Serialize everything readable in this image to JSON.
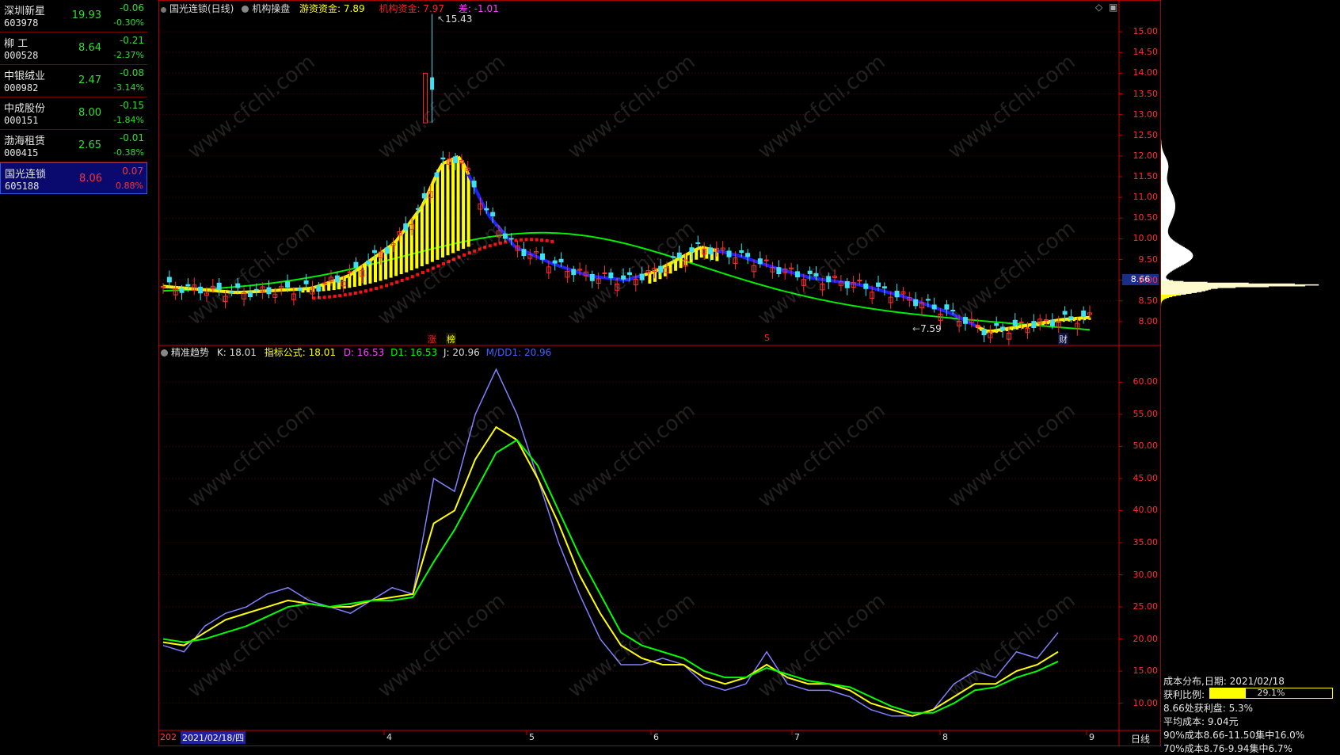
{
  "watchlist": [
    {
      "name": "深圳新星",
      "code": "603978",
      "price": "19.93",
      "change": "-0.06",
      "pct": "-0.30%",
      "dir": "down"
    },
    {
      "name": "柳 工",
      "code": "000528",
      "price": "8.64",
      "change": "-0.21",
      "pct": "-2.37%",
      "dir": "down"
    },
    {
      "name": "中银绒业",
      "code": "000982",
      "price": "2.47",
      "change": "-0.08",
      "pct": "-3.14%",
      "dir": "down"
    },
    {
      "name": "中成股份",
      "code": "000151",
      "price": "8.00",
      "change": "-0.15",
      "pct": "-1.84%",
      "dir": "down"
    },
    {
      "name": "渤海租赁",
      "code": "000415",
      "price": "2.65",
      "change": "-0.01",
      "pct": "-0.38%",
      "dir": "down"
    },
    {
      "name": "国光连锁",
      "code": "605188",
      "price": "8.06",
      "change": "0.07",
      "pct": "0.88%",
      "dir": "up"
    }
  ],
  "top_header": {
    "title": "国光连锁(日线)",
    "indicator": "机构操盘",
    "hot_money": "游资资金: 7.89",
    "inst_money": "机构资金: 7.97",
    "diff": "差: -1.01"
  },
  "bottom_header": {
    "indicator": "精准趋势",
    "k": "K: 18.01",
    "formula": "指标公式: 18.01",
    "d": "D: 16.53",
    "d1": "D1: 16.53",
    "j": "J: 20.96",
    "dd1": "M/DD1: 20.96"
  },
  "annotations": {
    "high": "15.43",
    "low": "7.59",
    "price_tag": "8.66",
    "zhang": "涨",
    "bang": "榜",
    "s": "S",
    "cai": "财"
  },
  "x_axis": {
    "prefix": "202",
    "date": "2021/02/18/四",
    "months": [
      "4",
      "5",
      "6",
      "7",
      "8",
      "9"
    ],
    "period": "日线"
  },
  "cost_panel": {
    "date_line": "成本分布,日期: 2021/02/18",
    "profit_label": "获利比例:",
    "profit_value": "29.1%",
    "profit_ratio": 0.291,
    "at_price": "8.66处获利盘: 5.3%",
    "avg_cost": "平均成本: 9.04元",
    "c90": "90%成本8.66-11.50集中16.0%",
    "c70": "70%成本8.76-9.94集中6.7%"
  },
  "watermark": "www.cfchi.com",
  "chart_data": [
    {
      "type": "candlestick",
      "title": "国光连锁(日线)",
      "ylim": [
        7.5,
        15.5
      ],
      "yticks": [
        8.0,
        8.5,
        9.0,
        9.5,
        10.0,
        10.5,
        11.0,
        11.5,
        12.0,
        12.5,
        13.0,
        13.5,
        14.0,
        14.5,
        15.0
      ],
      "series_lines": [
        {
          "name": "游资资金",
          "value_last": 7.89
        },
        {
          "name": "机构资金",
          "value_last": 7.97
        }
      ],
      "high": 15.43,
      "low": 7.59,
      "last_close": 8.06
    },
    {
      "type": "line",
      "title": "精准趋势",
      "ylim": [
        6,
        64
      ],
      "yticks": [
        10,
        15,
        20,
        25,
        30,
        35,
        40,
        45,
        50,
        55,
        60
      ],
      "series": [
        {
          "name": "J",
          "color": "#8080ff",
          "values": [
            19,
            18,
            22,
            24,
            25,
            27,
            28,
            26,
            25,
            24,
            26,
            28,
            27,
            45,
            43,
            55,
            62,
            55,
            45,
            35,
            27,
            20,
            16,
            16,
            17,
            16,
            13,
            12,
            13,
            18,
            13,
            12,
            12,
            11,
            9,
            8,
            8,
            9,
            13,
            15,
            14,
            18,
            17,
            21
          ]
        },
        {
          "name": "K",
          "color": "#ffff00",
          "values": [
            19.5,
            19,
            21,
            23,
            24,
            25,
            26,
            25.5,
            25,
            25,
            26,
            26.5,
            27,
            38,
            40,
            48,
            53,
            51,
            45,
            38,
            30,
            24,
            19,
            17,
            16,
            16,
            14,
            13,
            14,
            16,
            14,
            13,
            13,
            12,
            10,
            9,
            8,
            9,
            11,
            13,
            13,
            15,
            16,
            18
          ]
        },
        {
          "name": "D",
          "color": "#00ff00",
          "values": [
            20,
            19.5,
            20,
            21,
            22,
            23.5,
            25,
            25.5,
            25,
            25.5,
            26,
            26,
            26.5,
            32,
            37,
            43,
            49,
            51,
            47,
            40,
            33,
            27,
            21,
            19,
            18,
            17,
            15,
            14,
            14,
            15.5,
            14.5,
            13.5,
            13,
            12.5,
            11,
            9.5,
            8.5,
            8.5,
            10,
            12,
            12.5,
            14,
            15,
            16.5
          ]
        }
      ]
    }
  ]
}
